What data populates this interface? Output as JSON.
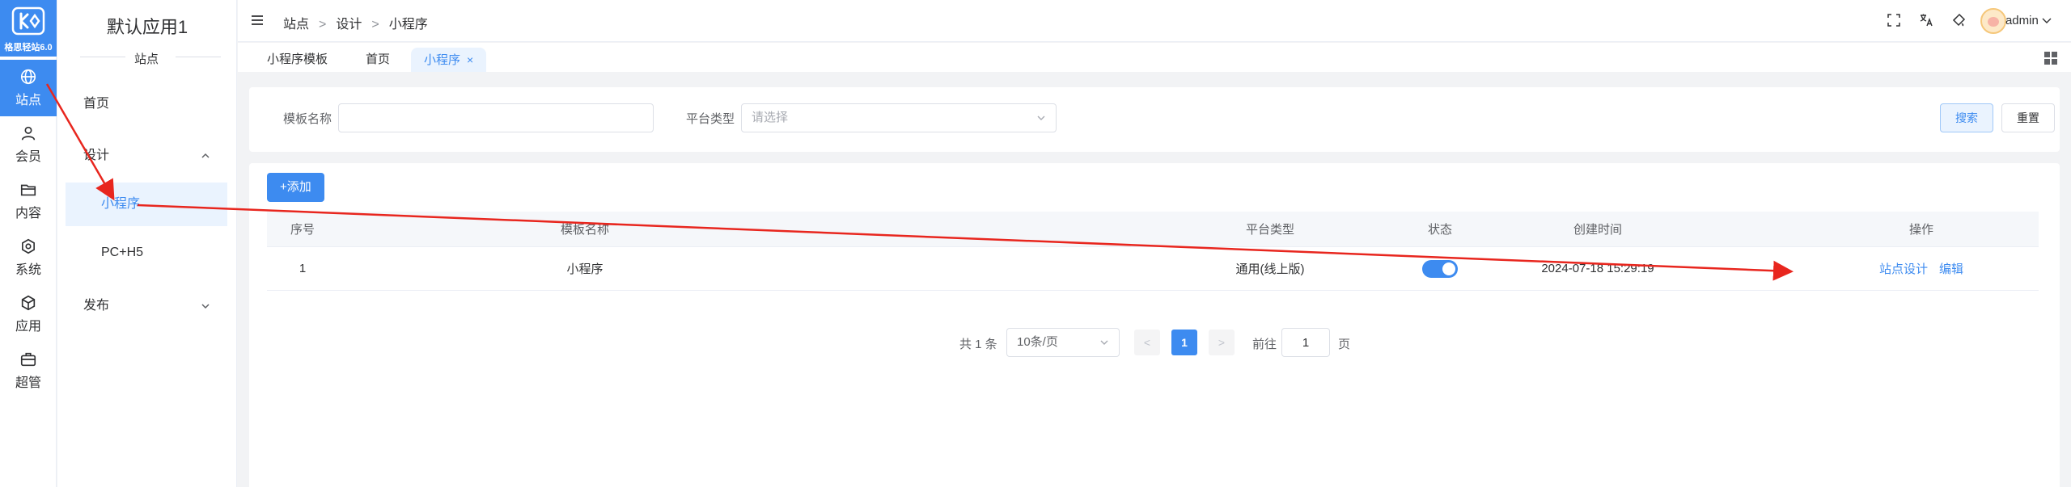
{
  "logo": {
    "text": "格思轻站6.0"
  },
  "rail": [
    {
      "label": "站点",
      "icon": "globe-icon",
      "active": true
    },
    {
      "label": "会员",
      "icon": "user-icon"
    },
    {
      "label": "内容",
      "icon": "folder-icon"
    },
    {
      "label": "系统",
      "icon": "gear-icon"
    },
    {
      "label": "应用",
      "icon": "cube-icon"
    },
    {
      "label": "超管",
      "icon": "briefcase-icon"
    }
  ],
  "submenu": {
    "app_title": "默认应用1",
    "section": "站点",
    "items": [
      {
        "label": "首页"
      },
      {
        "label": "设计"
      },
      {
        "label": "小程序"
      },
      {
        "label": "PC+H5"
      },
      {
        "label": "发布"
      }
    ]
  },
  "header": {
    "breadcrumb": [
      "站点",
      "设计",
      "小程序"
    ],
    "separator": ">",
    "user": "admin"
  },
  "tabs": [
    {
      "label": "小程序模板"
    },
    {
      "label": "首页"
    },
    {
      "label": "小程序",
      "close": "×"
    }
  ],
  "search": {
    "template_name_label": "模板名称",
    "template_name_value": "",
    "platform_label": "平台类型",
    "platform_placeholder": "请选择",
    "search_button": "搜索",
    "reset_button": "重置"
  },
  "table": {
    "add_button": "+添加",
    "columns": [
      "序号",
      "模板名称",
      "平台类型",
      "状态",
      "创建时间",
      "操作"
    ],
    "rows": [
      {
        "index": "1",
        "name": "小程序",
        "platform": "通用(线上版)",
        "status_on": true,
        "created": "2024-07-18 15:29:19",
        "actions": [
          "站点设计",
          "编辑"
        ]
      }
    ]
  },
  "pagination": {
    "total": "共 1 条",
    "page_size": "10条/页",
    "prev": "<",
    "current": "1",
    "next": ">",
    "goto_prefix": "前往",
    "goto_value": "1",
    "goto_suffix": "页"
  },
  "colors": {
    "primary": "#3d8bf0",
    "annotation_arrow": "#e8261e"
  }
}
